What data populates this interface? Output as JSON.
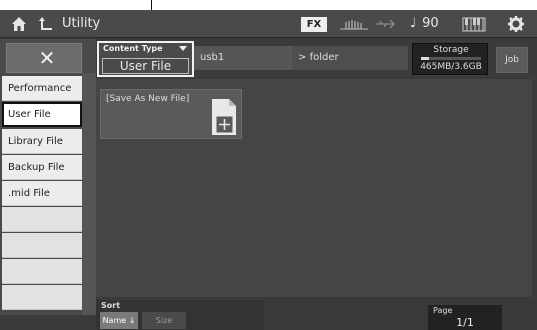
{
  "header": {
    "title": "Utility",
    "fx_label": "FX",
    "tempo": "90",
    "tempo_symbol": "♩"
  },
  "content_type": {
    "label": "Content Type",
    "value": "User File"
  },
  "path": {
    "usb": "usb1",
    "folder": "folder"
  },
  "storage": {
    "label": "Storage",
    "value": "465MB/3.6GB"
  },
  "job_label": "Job",
  "dropdown_options": [
    "Performance",
    "User File",
    "Library File",
    "Backup File",
    ".mid File"
  ],
  "selected_option": "User File",
  "new_file_label": "[Save As New File]",
  "sort": {
    "label": "Sort",
    "name_label": "Name ↓",
    "size_label": "Size"
  },
  "page": {
    "label": "Page",
    "value": "1/1"
  },
  "colors": {
    "background": "#3b3b3b",
    "list_bg": "#ececec",
    "accent": "#f2f2f2"
  }
}
